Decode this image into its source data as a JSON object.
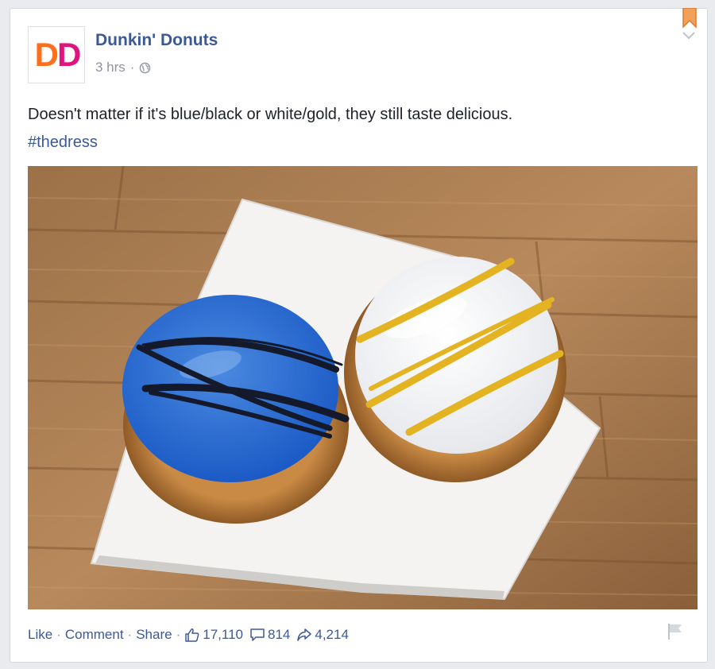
{
  "post": {
    "author": "Dunkin' Donuts",
    "avatar_text": "DD",
    "time": "3 hrs",
    "separator": "·",
    "text": "Doesn't matter if it's blue/black or white/gold, they still taste delicious.",
    "hashtag": "#thedress"
  },
  "actions": {
    "like": "Like",
    "comment": "Comment",
    "share": "Share",
    "separator": "·"
  },
  "stats": {
    "likes": "17,110",
    "comments": "814",
    "shares": "4,214"
  },
  "colors": {
    "link": "#3b5998",
    "muted": "#90949c",
    "brand_orange": "#ff6e1b",
    "brand_pink": "#e0147c"
  },
  "icons": [
    "globe-icon",
    "bookmark-icon",
    "chevron-down-icon",
    "like-icon",
    "comment-icon",
    "share-icon",
    "flag-icon"
  ]
}
